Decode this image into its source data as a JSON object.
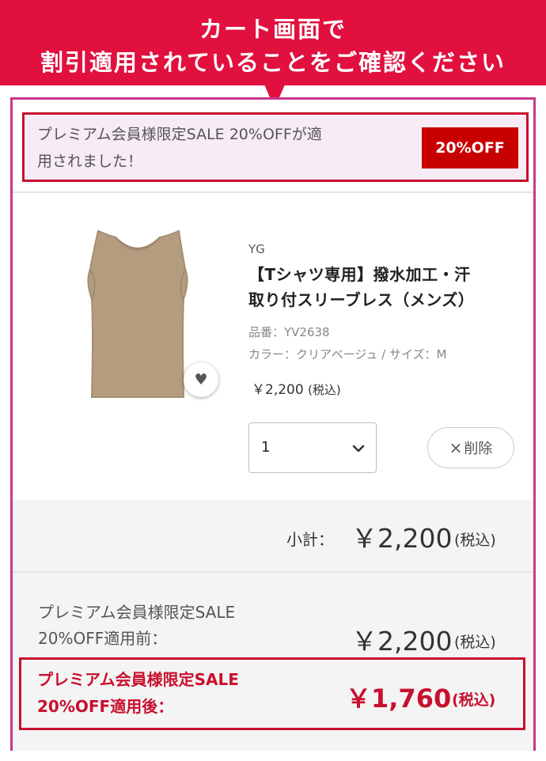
{
  "banner": {
    "line1": "カート画面で",
    "line2": "割引適用されていることをご確認ください"
  },
  "notice": {
    "text_line1": "プレミアム会員様限定SALE 20%OFFが適",
    "text_line2": "用されました！",
    "badge": "20%OFF"
  },
  "product": {
    "brand": "YG",
    "name_line1": "【Tシャツ専用】撥水加工・汗",
    "name_line2": "取り付スリーブレス（メンズ）",
    "code": "品番：YV2638",
    "attrs": "カラー：クリアベージュ / サイズ：M",
    "price": "￥2,200",
    "price_tax": "(税込)",
    "image_icon": "sleeveless-shirt-image",
    "fav_icon": "heart-icon",
    "quantity": "1",
    "delete_label": "削除"
  },
  "subtotal": {
    "label": "小計：",
    "amount": "￥2,200",
    "tax": "(税込)"
  },
  "before": {
    "label_line1": "プレミアム会員様限定SALE",
    "label_line2": "20%OFF適用前：",
    "amount": "￥2,200",
    "tax": "(税込)"
  },
  "after": {
    "label_line1": "プレミアム会員様限定SALE",
    "label_line2": "20%OFF適用後：",
    "amount": "￥1,760",
    "tax": "(税込)"
  },
  "colors": {
    "banner": "#e1103f",
    "accent_red": "#c8102e",
    "card_border": "#c9378b",
    "badge": "#c80000"
  }
}
